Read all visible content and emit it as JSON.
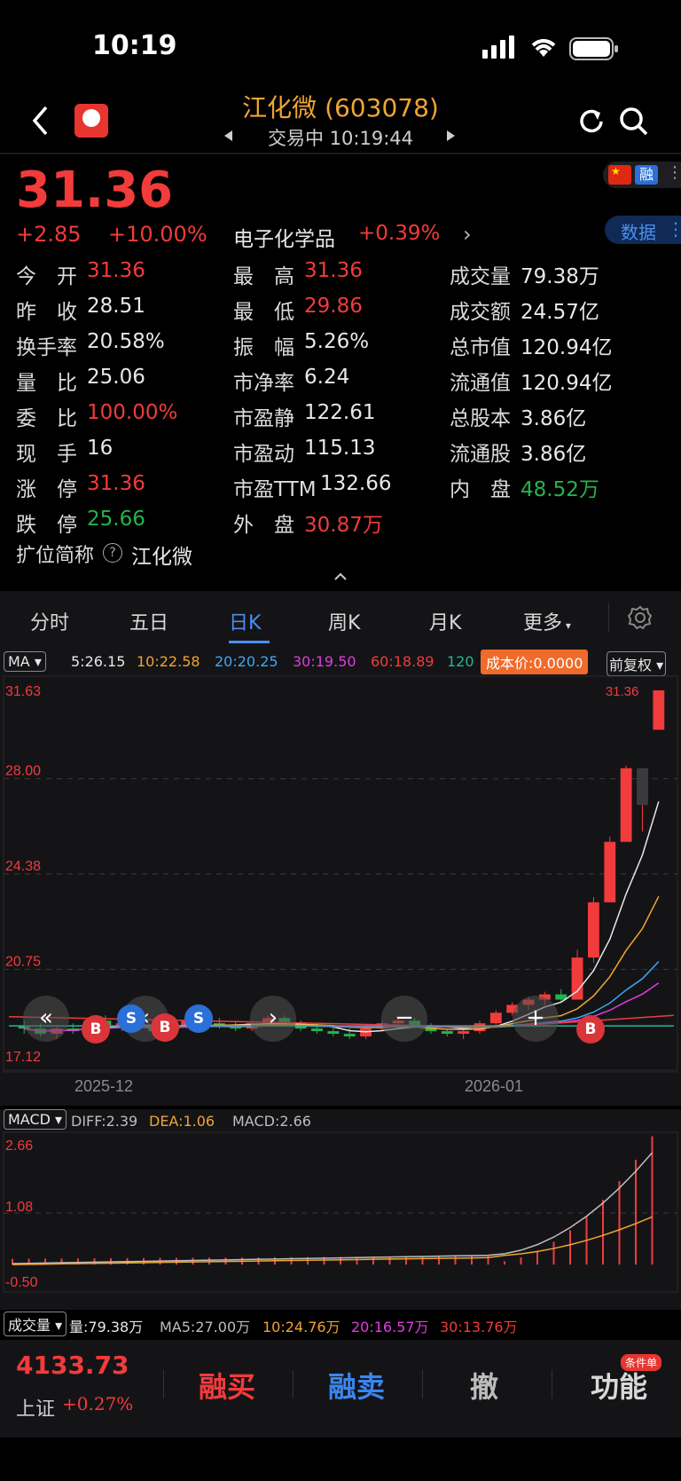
{
  "status_bar": {
    "time": "10:19"
  },
  "header": {
    "title": "江化微 (603078)",
    "subtitle": "交易中 10:19:44"
  },
  "quote": {
    "price": "31.36",
    "change": "+2.85",
    "change_pct": "+10.00%",
    "sector": "电子化学品",
    "sector_pct": "+0.39%",
    "sector_arrow": "›",
    "rong_badge": "融",
    "data_button": "数据"
  },
  "stats": [
    {
      "label": "今　开",
      "value": "31.36",
      "color": "#f23b3b"
    },
    {
      "label": "最　高",
      "value": "31.36",
      "color": "#f23b3b"
    },
    {
      "label": "成交量",
      "value": "79.38万",
      "color": "#e8e8e8"
    },
    {
      "label": "昨　收",
      "value": "28.51",
      "color": "#e8e8e8"
    },
    {
      "label": "最　低",
      "value": "29.86",
      "color": "#f23b3b"
    },
    {
      "label": "成交额",
      "value": "24.57亿",
      "color": "#e8e8e8"
    },
    {
      "label": "换手率",
      "value": "20.58%",
      "color": "#e8e8e8"
    },
    {
      "label": "振　幅",
      "value": "5.26%",
      "color": "#e8e8e8"
    },
    {
      "label": "总市值",
      "value": "120.94亿",
      "color": "#e8e8e8"
    },
    {
      "label": "量　比",
      "value": "25.06",
      "color": "#e8e8e8"
    },
    {
      "label": "市净率",
      "value": "6.24",
      "color": "#e8e8e8"
    },
    {
      "label": "流通值",
      "value": "120.94亿",
      "color": "#e8e8e8"
    },
    {
      "label": "委　比",
      "value": "100.00%",
      "color": "#f23b3b"
    },
    {
      "label": "市盈静",
      "value": "122.61",
      "color": "#e8e8e8"
    },
    {
      "label": "总股本",
      "value": "3.86亿",
      "color": "#e8e8e8"
    },
    {
      "label": "现　手",
      "value": "16",
      "color": "#e8e8e8"
    },
    {
      "label": "市盈动",
      "value": "115.13",
      "color": "#e8e8e8"
    },
    {
      "label": "流通股",
      "value": "3.86亿",
      "color": "#e8e8e8"
    },
    {
      "label": "涨　停",
      "value": "31.36",
      "color": "#f23b3b"
    },
    {
      "label": "市盈TTM",
      "value": "132.66",
      "color": "#e8e8e8"
    },
    {
      "label": "内　盘",
      "value": "48.52万",
      "color": "#25b34a"
    },
    {
      "label": "跌　停",
      "value": "25.66",
      "color": "#25b34a"
    },
    {
      "label": "外　盘",
      "value": "30.87万",
      "color": "#f23b3b"
    }
  ],
  "short_name": {
    "label": "扩位简称",
    "value": "江化微"
  },
  "tabs": [
    "分时",
    "五日",
    "日K",
    "周K",
    "月K",
    "更多"
  ],
  "ma_bar": {
    "selector": "MA",
    "ma5": "5:26.15",
    "ma10": "10:22.58",
    "ma20": "20:20.25",
    "ma30": "30:19.50",
    "ma60": "60:18.89",
    "ma120": "120",
    "cost_price": "成本价:0.0000",
    "adjust": "前复权"
  },
  "kline_axis": {
    "y_ticks": [
      "31.63",
      "28.00",
      "24.38",
      "20.75",
      "17.12"
    ],
    "last_label": "31.36",
    "x_ticks": [
      "2025-12",
      "2026-01"
    ]
  },
  "macd": {
    "selector": "MACD",
    "diff": "DIFF:2.39",
    "dea": "DEA:1.06",
    "macd": "MACD:2.66",
    "y_ticks": [
      "2.66",
      "1.08",
      "-0.50"
    ]
  },
  "volume": {
    "selector": "成交量",
    "vol": "量:79.38万",
    "ma5": "MA5:27.00万",
    "ma10": "10:24.76万",
    "ma20": "20:16.57万",
    "ma30": "30:13.76万"
  },
  "bottom": {
    "index_value": "4133.73",
    "index_name": "上证",
    "index_pct": "+0.27%",
    "buy": "融买",
    "sell": "融卖",
    "cancel": "撤",
    "func": "功能",
    "func_badge": "条件单"
  },
  "trade_markers": [
    "B",
    "S",
    "B",
    "S",
    "B"
  ],
  "chart_data": {
    "type": "candlestick",
    "y_range": [
      17.12,
      31.63
    ],
    "x_ticks": [
      "2025-12",
      "2026-01"
    ],
    "ohlc": [
      [
        18.6,
        18.8,
        18.3,
        18.5
      ],
      [
        18.5,
        18.7,
        18.2,
        18.3
      ],
      [
        18.3,
        18.6,
        18.1,
        18.5
      ],
      [
        18.5,
        18.7,
        18.3,
        18.4
      ],
      [
        18.4,
        18.9,
        18.3,
        18.8
      ],
      [
        18.8,
        19.0,
        18.5,
        18.6
      ],
      [
        18.6,
        18.8,
        18.4,
        18.7
      ],
      [
        18.7,
        18.9,
        18.5,
        18.6
      ],
      [
        18.6,
        18.8,
        18.3,
        18.4
      ],
      [
        18.4,
        18.7,
        18.3,
        18.6
      ],
      [
        18.6,
        18.9,
        18.5,
        18.8
      ],
      [
        18.8,
        19.0,
        18.6,
        18.7
      ],
      [
        18.7,
        18.9,
        18.5,
        18.6
      ],
      [
        18.6,
        18.8,
        18.4,
        18.5
      ],
      [
        18.5,
        18.8,
        18.4,
        18.7
      ],
      [
        18.7,
        19.0,
        18.6,
        18.9
      ],
      [
        18.9,
        19.0,
        18.6,
        18.7
      ],
      [
        18.7,
        18.8,
        18.4,
        18.5
      ],
      [
        18.5,
        18.7,
        18.3,
        18.4
      ],
      [
        18.4,
        18.6,
        18.2,
        18.3
      ],
      [
        18.3,
        18.5,
        18.1,
        18.2
      ],
      [
        18.2,
        18.6,
        18.1,
        18.5
      ],
      [
        18.5,
        18.8,
        18.4,
        18.7
      ],
      [
        18.7,
        18.9,
        18.5,
        18.8
      ],
      [
        18.8,
        18.9,
        18.5,
        18.6
      ],
      [
        18.6,
        18.7,
        18.3,
        18.4
      ],
      [
        18.4,
        18.5,
        18.2,
        18.3
      ],
      [
        18.3,
        18.5,
        18.1,
        18.4
      ],
      [
        18.4,
        18.8,
        18.3,
        18.7
      ],
      [
        18.7,
        19.2,
        18.6,
        19.1
      ],
      [
        19.1,
        19.5,
        19.0,
        19.4
      ],
      [
        19.4,
        19.7,
        19.2,
        19.6
      ],
      [
        19.6,
        19.9,
        19.4,
        19.8
      ],
      [
        19.8,
        20.0,
        19.5,
        19.6
      ],
      [
        19.6,
        21.5,
        19.6,
        21.2
      ],
      [
        21.2,
        23.5,
        21.0,
        23.3
      ],
      [
        23.3,
        25.8,
        23.3,
        25.6
      ],
      [
        25.6,
        28.5,
        25.6,
        28.4
      ],
      [
        28.4,
        28.4,
        26.0,
        27.0
      ],
      [
        29.86,
        31.36,
        29.86,
        31.36
      ]
    ]
  }
}
